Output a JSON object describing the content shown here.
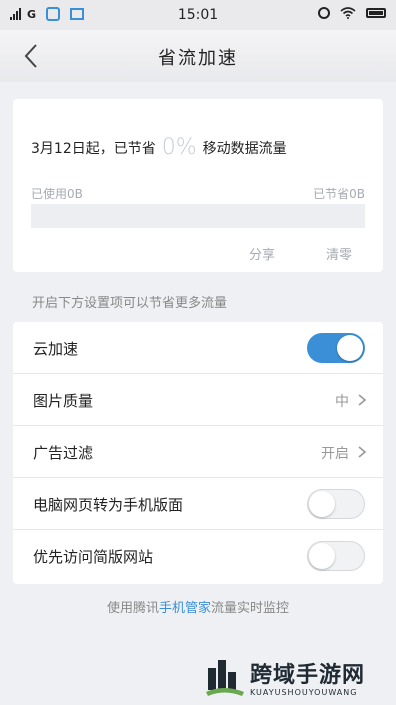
{
  "status_bar": {
    "carrier": "G",
    "time": "15:01",
    "icons": [
      "signal-icon",
      "app-notification-icon",
      "image-notification-icon",
      "alarm-icon",
      "wifi-icon",
      "battery-icon"
    ]
  },
  "header": {
    "title": "省流加速",
    "back_icon": "back-chevron-icon"
  },
  "summary": {
    "prefix": "3月12日起，已节省",
    "percent": "0%",
    "suffix": "移动数据流量",
    "used_label": "已使用0B",
    "saved_label": "已节省0B",
    "progress": 0,
    "share_label": "分享",
    "clear_label": "清零"
  },
  "hint": "开启下方设置项可以节省更多流量",
  "settings": [
    {
      "label": "云加速",
      "type": "toggle",
      "on": true
    },
    {
      "label": "图片质量",
      "type": "select",
      "value": "中"
    },
    {
      "label": "广告过滤",
      "type": "select",
      "value": "开启"
    },
    {
      "label": "电脑网页转为手机版面",
      "type": "toggle",
      "on": false
    },
    {
      "label": "优先访问简版网站",
      "type": "toggle",
      "on": false
    }
  ],
  "footer": {
    "prefix": "使用腾讯",
    "link": "手机管家",
    "suffix": "流量实时监控"
  },
  "watermark": {
    "title": "跨域手游网",
    "subtitle": "KUAYUSHOUYOUWANG"
  },
  "colors": {
    "accent": "#3a8fd6",
    "background": "#eef0f4"
  }
}
